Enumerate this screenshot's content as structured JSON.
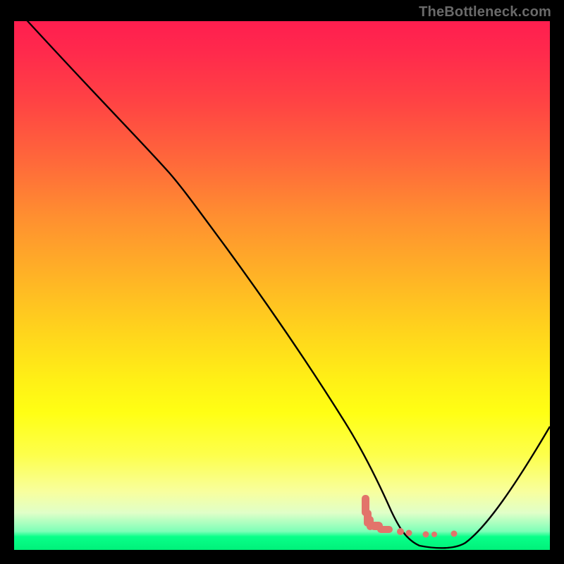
{
  "watermark": "TheBottleneck.com",
  "chart_data": {
    "type": "line",
    "title": "",
    "xlabel": "",
    "ylabel": "",
    "xlim": [
      0,
      100
    ],
    "ylim": [
      0,
      100
    ],
    "series": [
      {
        "name": "bottleneck-curve",
        "x": [
          0,
          12,
          25,
          30,
          40,
          50,
          60,
          65,
          68,
          72,
          76,
          80,
          84,
          90,
          95,
          100
        ],
        "y": [
          100,
          87,
          74,
          69,
          55,
          41,
          27,
          18,
          11,
          5,
          2,
          0.5,
          0.5,
          5,
          13,
          24
        ]
      }
    ],
    "highlight_points": {
      "name": "optimal-band",
      "x": [
        65.5,
        66.5,
        67.5,
        68.5,
        69.5,
        70.5,
        72,
        75,
        78,
        80.5
      ],
      "y": [
        8.5,
        7,
        5.5,
        4.2,
        3.0,
        2.2,
        1.2,
        0.6,
        0.6,
        0.6
      ]
    },
    "colors": {
      "gradient_top": "#ff1e4f",
      "gradient_mid": "#ffff14",
      "gradient_bottom": "#00f17a",
      "curve": "#000000",
      "highlight": "#e2746b",
      "background": "#000000"
    }
  }
}
